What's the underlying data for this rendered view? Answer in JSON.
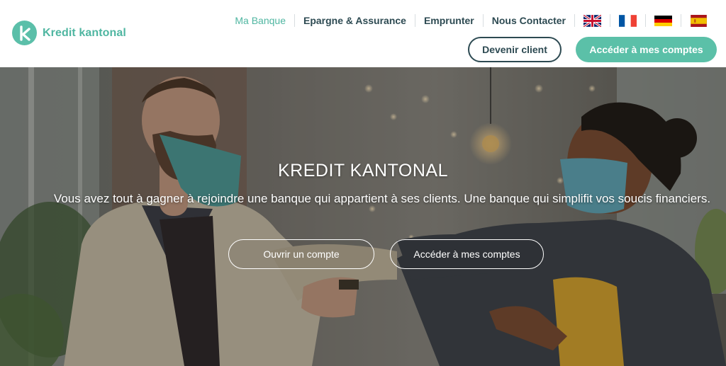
{
  "brand": {
    "name": "Kredit kantonal",
    "accent": "#5bbfa9",
    "dark": "#2d4a52"
  },
  "nav": {
    "items": [
      {
        "label": "Ma Banque",
        "active": true
      },
      {
        "label": "Epargne & Assurance",
        "active": false
      },
      {
        "label": "Emprunter",
        "active": false
      },
      {
        "label": "Nous Contacter",
        "active": false
      }
    ],
    "languages": [
      "uk-flag-icon",
      "france-flag-icon",
      "germany-flag-icon",
      "spain-flag-icon"
    ]
  },
  "header_buttons": {
    "become_client": "Devenir client",
    "access_accounts": "Accéder à mes comptes"
  },
  "hero": {
    "title": "KREDIT KANTONAL",
    "subtitle": "Vous avez tout à gagner à rejoindre une banque qui appartient à ses clients. Une banque qui simplifit vos soucis financiers.",
    "open_account": "Ouvrir un compte",
    "access_accounts": "Accéder à mes comptes"
  }
}
